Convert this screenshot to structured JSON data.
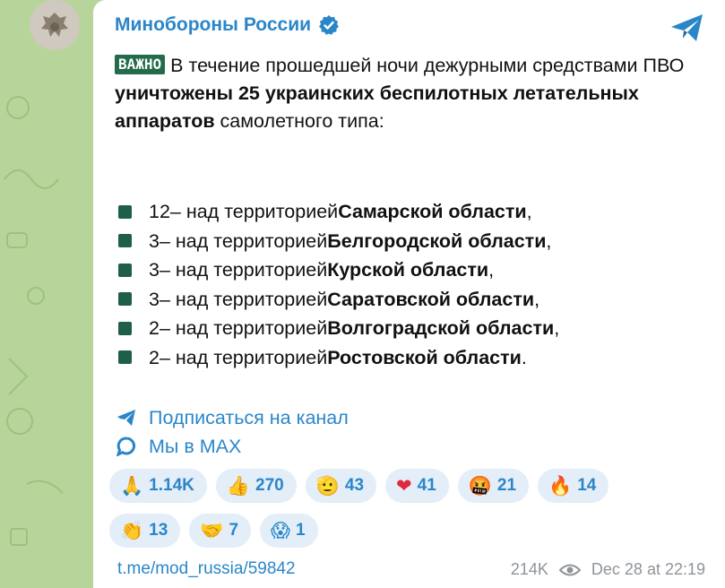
{
  "channel": {
    "name": "Минобороны России"
  },
  "post": {
    "badge": "ВАЖНО",
    "intro_1": " В течение прошедшей ночи дежурными средствами ПВО ",
    "intro_bold": "уничтожены 25 украинских беспилотных летательных аппаратов",
    "intro_2": " самолетного типа:",
    "items": [
      {
        "count": "12",
        "mid": " – над территорией ",
        "region": "Самарской области",
        "end": ","
      },
      {
        "count": "3",
        "mid": " – над территорией ",
        "region": "Белгородской области",
        "end": ","
      },
      {
        "count": "3",
        "mid": " – над территорией ",
        "region": "Курской области",
        "end": ","
      },
      {
        "count": "3",
        "mid": " – над территорией ",
        "region": "Саратовской области",
        "end": ","
      },
      {
        "count": "2",
        "mid": " – над территорией ",
        "region": "Волгоградской области",
        "end": ","
      },
      {
        "count": "2",
        "mid": " – над территорией ",
        "region": "Ростовской области",
        "end": "."
      }
    ],
    "links": [
      {
        "icon": "paper-plane-icon",
        "label": "Подписаться на канал"
      },
      {
        "icon": "chat-bubble-icon",
        "label": "Мы в MAX"
      }
    ]
  },
  "reactions": {
    "row1": [
      {
        "emoji": "🙏",
        "count": "1.14K"
      },
      {
        "emoji": "👍",
        "count": "270"
      },
      {
        "emoji": "🫡",
        "count": "43"
      },
      {
        "emoji": "❤",
        "count": "41"
      },
      {
        "emoji": "🤬",
        "count": "21"
      },
      {
        "emoji": "🔥",
        "count": "14"
      }
    ],
    "row2": [
      {
        "emoji": "👏",
        "count": "13"
      },
      {
        "emoji": "🤝",
        "count": "7"
      },
      {
        "emoji": "😱",
        "count": "1"
      }
    ]
  },
  "footer": {
    "link": "t.me/mod_russia/59842",
    "views": "214K",
    "timestamp": "Dec 28 at 22:19"
  },
  "colors": {
    "accent": "#2a86c9",
    "badge": "#236b4a",
    "bullet": "#1f5f49",
    "reaction_bg": "#e3eef8",
    "background": "#b7d59a"
  }
}
